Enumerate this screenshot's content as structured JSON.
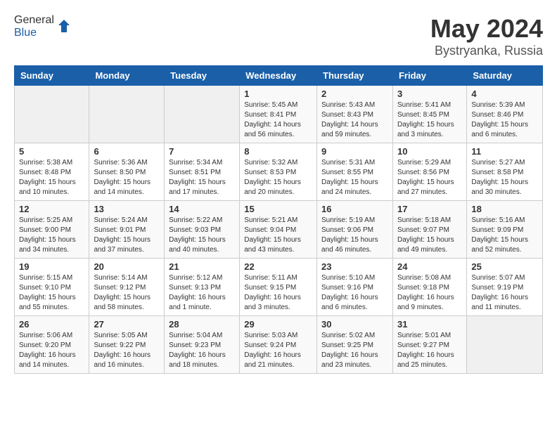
{
  "header": {
    "logo_general": "General",
    "logo_blue": "Blue",
    "title": "May 2024",
    "subtitle": "Bystryanka, Russia"
  },
  "weekdays": [
    "Sunday",
    "Monday",
    "Tuesday",
    "Wednesday",
    "Thursday",
    "Friday",
    "Saturday"
  ],
  "weeks": [
    [
      {
        "day": "",
        "detail": ""
      },
      {
        "day": "",
        "detail": ""
      },
      {
        "day": "",
        "detail": ""
      },
      {
        "day": "1",
        "detail": "Sunrise: 5:45 AM\nSunset: 8:41 PM\nDaylight: 14 hours\nand 56 minutes."
      },
      {
        "day": "2",
        "detail": "Sunrise: 5:43 AM\nSunset: 8:43 PM\nDaylight: 14 hours\nand 59 minutes."
      },
      {
        "day": "3",
        "detail": "Sunrise: 5:41 AM\nSunset: 8:45 PM\nDaylight: 15 hours\nand 3 minutes."
      },
      {
        "day": "4",
        "detail": "Sunrise: 5:39 AM\nSunset: 8:46 PM\nDaylight: 15 hours\nand 6 minutes."
      }
    ],
    [
      {
        "day": "5",
        "detail": "Sunrise: 5:38 AM\nSunset: 8:48 PM\nDaylight: 15 hours\nand 10 minutes."
      },
      {
        "day": "6",
        "detail": "Sunrise: 5:36 AM\nSunset: 8:50 PM\nDaylight: 15 hours\nand 14 minutes."
      },
      {
        "day": "7",
        "detail": "Sunrise: 5:34 AM\nSunset: 8:51 PM\nDaylight: 15 hours\nand 17 minutes."
      },
      {
        "day": "8",
        "detail": "Sunrise: 5:32 AM\nSunset: 8:53 PM\nDaylight: 15 hours\nand 20 minutes."
      },
      {
        "day": "9",
        "detail": "Sunrise: 5:31 AM\nSunset: 8:55 PM\nDaylight: 15 hours\nand 24 minutes."
      },
      {
        "day": "10",
        "detail": "Sunrise: 5:29 AM\nSunset: 8:56 PM\nDaylight: 15 hours\nand 27 minutes."
      },
      {
        "day": "11",
        "detail": "Sunrise: 5:27 AM\nSunset: 8:58 PM\nDaylight: 15 hours\nand 30 minutes."
      }
    ],
    [
      {
        "day": "12",
        "detail": "Sunrise: 5:25 AM\nSunset: 9:00 PM\nDaylight: 15 hours\nand 34 minutes."
      },
      {
        "day": "13",
        "detail": "Sunrise: 5:24 AM\nSunset: 9:01 PM\nDaylight: 15 hours\nand 37 minutes."
      },
      {
        "day": "14",
        "detail": "Sunrise: 5:22 AM\nSunset: 9:03 PM\nDaylight: 15 hours\nand 40 minutes."
      },
      {
        "day": "15",
        "detail": "Sunrise: 5:21 AM\nSunset: 9:04 PM\nDaylight: 15 hours\nand 43 minutes."
      },
      {
        "day": "16",
        "detail": "Sunrise: 5:19 AM\nSunset: 9:06 PM\nDaylight: 15 hours\nand 46 minutes."
      },
      {
        "day": "17",
        "detail": "Sunrise: 5:18 AM\nSunset: 9:07 PM\nDaylight: 15 hours\nand 49 minutes."
      },
      {
        "day": "18",
        "detail": "Sunrise: 5:16 AM\nSunset: 9:09 PM\nDaylight: 15 hours\nand 52 minutes."
      }
    ],
    [
      {
        "day": "19",
        "detail": "Sunrise: 5:15 AM\nSunset: 9:10 PM\nDaylight: 15 hours\nand 55 minutes."
      },
      {
        "day": "20",
        "detail": "Sunrise: 5:14 AM\nSunset: 9:12 PM\nDaylight: 15 hours\nand 58 minutes."
      },
      {
        "day": "21",
        "detail": "Sunrise: 5:12 AM\nSunset: 9:13 PM\nDaylight: 16 hours\nand 1 minute."
      },
      {
        "day": "22",
        "detail": "Sunrise: 5:11 AM\nSunset: 9:15 PM\nDaylight: 16 hours\nand 3 minutes."
      },
      {
        "day": "23",
        "detail": "Sunrise: 5:10 AM\nSunset: 9:16 PM\nDaylight: 16 hours\nand 6 minutes."
      },
      {
        "day": "24",
        "detail": "Sunrise: 5:08 AM\nSunset: 9:18 PM\nDaylight: 16 hours\nand 9 minutes."
      },
      {
        "day": "25",
        "detail": "Sunrise: 5:07 AM\nSunset: 9:19 PM\nDaylight: 16 hours\nand 11 minutes."
      }
    ],
    [
      {
        "day": "26",
        "detail": "Sunrise: 5:06 AM\nSunset: 9:20 PM\nDaylight: 16 hours\nand 14 minutes."
      },
      {
        "day": "27",
        "detail": "Sunrise: 5:05 AM\nSunset: 9:22 PM\nDaylight: 16 hours\nand 16 minutes."
      },
      {
        "day": "28",
        "detail": "Sunrise: 5:04 AM\nSunset: 9:23 PM\nDaylight: 16 hours\nand 18 minutes."
      },
      {
        "day": "29",
        "detail": "Sunrise: 5:03 AM\nSunset: 9:24 PM\nDaylight: 16 hours\nand 21 minutes."
      },
      {
        "day": "30",
        "detail": "Sunrise: 5:02 AM\nSunset: 9:25 PM\nDaylight: 16 hours\nand 23 minutes."
      },
      {
        "day": "31",
        "detail": "Sunrise: 5:01 AM\nSunset: 9:27 PM\nDaylight: 16 hours\nand 25 minutes."
      },
      {
        "day": "",
        "detail": ""
      }
    ]
  ]
}
